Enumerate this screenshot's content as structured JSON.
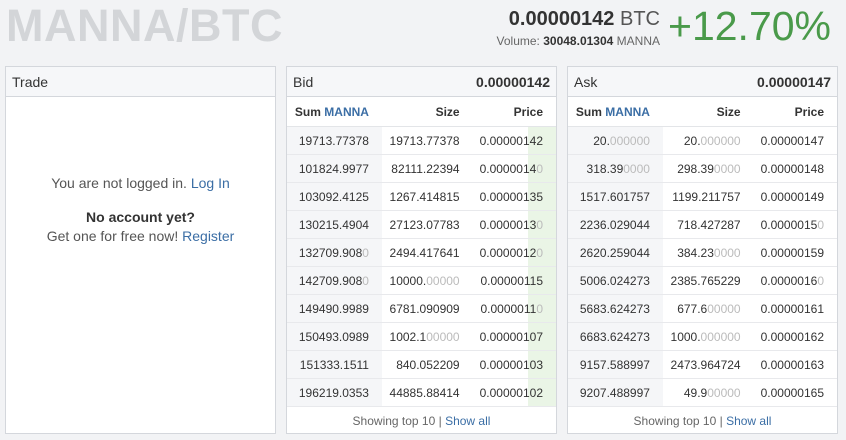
{
  "header": {
    "pair": "MANNA/BTC",
    "last_price": "0.00000142",
    "last_currency": "BTC",
    "volume_label": "Volume:",
    "volume_value": "30048.01304",
    "volume_currency": "MANNA",
    "change": "+12.70%"
  },
  "colors": {
    "positive": "#4a9a4a",
    "link": "#3b6ea5",
    "depth": "#eaf5e6"
  },
  "trade": {
    "title": "Trade",
    "not_logged_text": "You are not logged in.",
    "login_link": "Log In",
    "no_account": "No account yet?",
    "get_one_text": "Get one for free now!",
    "register_link": "Register"
  },
  "bid": {
    "title": "Bid",
    "best": "0.00000142",
    "columns": {
      "sum_prefix": "Sum",
      "sum_currency": "MANNA",
      "size": "Size",
      "price": "Price"
    },
    "rows": [
      {
        "sum": "19713.77378",
        "size": "19713.77378",
        "price": "0.00000142"
      },
      {
        "sum": "101824.9977",
        "size": "82111.22394",
        "price": "0.00000140"
      },
      {
        "sum": "103092.4125",
        "size": "1267.414815",
        "price": "0.00000135"
      },
      {
        "sum": "130215.4904",
        "size": "27123.07783",
        "price": "0.00000130"
      },
      {
        "sum": "132709.9080",
        "size": "2494.417641",
        "price": "0.00000120"
      },
      {
        "sum": "142709.9080",
        "size": "10000.00000",
        "price": "0.00000115"
      },
      {
        "sum": "149490.9989",
        "size": "6781.090909",
        "price": "0.00000110"
      },
      {
        "sum": "150493.0989",
        "size": "1002.100000",
        "price": "0.00000107"
      },
      {
        "sum": "151333.1511",
        "size": "840.052209",
        "price": "0.00000103"
      },
      {
        "sum": "196219.0353",
        "size": "44885.88414",
        "price": "0.00000102"
      }
    ],
    "footer_text": "Showing top 10 |",
    "show_all": "Show all"
  },
  "ask": {
    "title": "Ask",
    "best": "0.00000147",
    "columns": {
      "sum_prefix": "Sum",
      "sum_currency": "MANNA",
      "size": "Size",
      "price": "Price"
    },
    "rows": [
      {
        "sum": "20.000000",
        "size": "20.000000",
        "price": "0.00000147"
      },
      {
        "sum": "318.390000",
        "size": "298.390000",
        "price": "0.00000148"
      },
      {
        "sum": "1517.601757",
        "size": "1199.211757",
        "price": "0.00000149"
      },
      {
        "sum": "2236.029044",
        "size": "718.427287",
        "price": "0.00000150"
      },
      {
        "sum": "2620.259044",
        "size": "384.230000",
        "price": "0.00000159"
      },
      {
        "sum": "5006.024273",
        "size": "2385.765229",
        "price": "0.00000160"
      },
      {
        "sum": "5683.624273",
        "size": "677.600000",
        "price": "0.00000161"
      },
      {
        "sum": "6683.624273",
        "size": "1000.000000",
        "price": "0.00000162"
      },
      {
        "sum": "9157.588997",
        "size": "2473.964724",
        "price": "0.00000163"
      },
      {
        "sum": "9207.488997",
        "size": "49.900000",
        "price": "0.00000165"
      }
    ],
    "footer_text": "Showing top 10 |",
    "show_all": "Show all"
  }
}
